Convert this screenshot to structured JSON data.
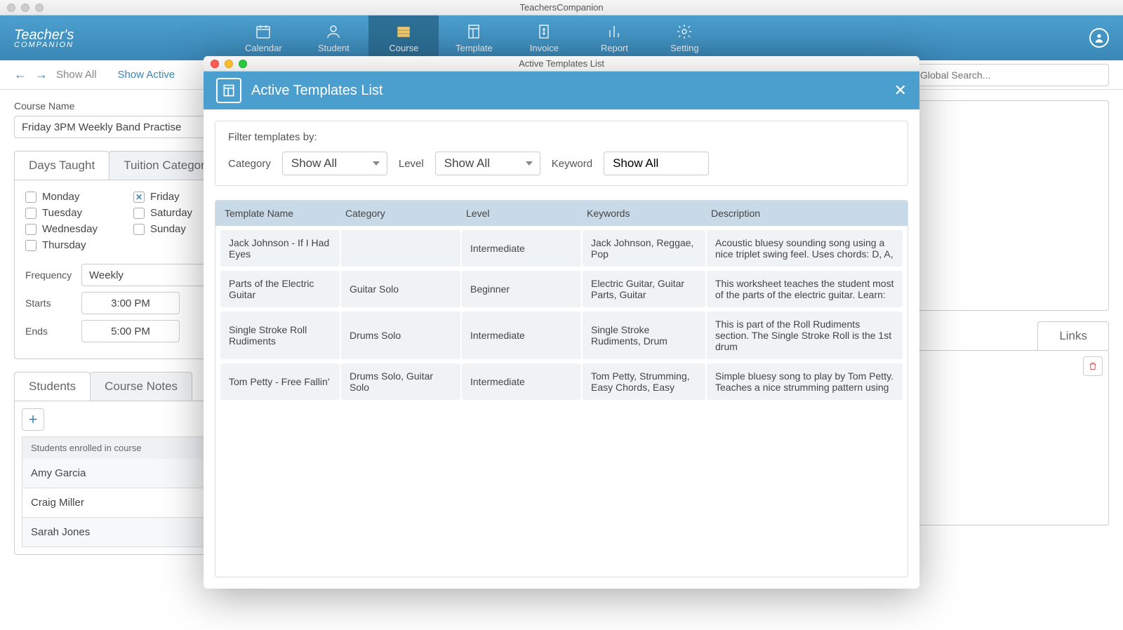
{
  "window": {
    "title": "TeachersCompanion"
  },
  "logo": {
    "line1": "Teacher's",
    "line2": "COMPANION"
  },
  "nav": {
    "items": [
      {
        "label": "Calendar"
      },
      {
        "label": "Student"
      },
      {
        "label": "Course"
      },
      {
        "label": "Template"
      },
      {
        "label": "Invoice"
      },
      {
        "label": "Report"
      },
      {
        "label": "Setting"
      }
    ]
  },
  "toolbar": {
    "show_all": "Show All",
    "show_active": "Show Active",
    "search_placeholder": "Global Search..."
  },
  "course": {
    "name_label": "Course Name",
    "name_value": "Friday 3PM Weekly Band Practise",
    "tabs": {
      "days": "Days Taught",
      "tuition": "Tuition Category"
    },
    "days": {
      "monday": "Monday",
      "tuesday": "Tuesday",
      "wednesday": "Wednesday",
      "thursday": "Thursday",
      "friday": "Friday",
      "saturday": "Saturday",
      "sunday": "Sunday"
    },
    "frequency_label": "Frequency",
    "frequency_value": "Weekly",
    "starts_label": "Starts",
    "starts_value": "3:00 PM",
    "ends_label": "Ends",
    "ends_value": "5:00 PM",
    "students_tab": "Students",
    "notes_tab": "Course Notes",
    "enrolled_header": "Students enrolled in course",
    "students": [
      "Amy Garcia",
      "Craig Miller",
      "Sarah Jones"
    ],
    "links_tab": "Links"
  },
  "modal": {
    "mac_title": "Active Templates List",
    "title": "Active Templates List",
    "filter_title": "Filter templates by:",
    "category_label": "Category",
    "category_value": "Show All",
    "level_label": "Level",
    "level_value": "Show All",
    "keyword_label": "Keyword",
    "keyword_value": "Show All",
    "columns": {
      "name": "Template Name",
      "category": "Category",
      "level": "Level",
      "keywords": "Keywords",
      "description": "Description"
    },
    "rows": [
      {
        "name": "Jack Johnson - If I Had Eyes",
        "category": "",
        "level": "Intermediate",
        "keywords": "Jack Johnson, Reggae, Pop",
        "description": "Acoustic bluesy sounding song using a nice triplet swing feel.  Uses chords: D, A,"
      },
      {
        "name": "Parts of the Electric Guitar",
        "category": "Guitar Solo",
        "level": "Beginner",
        "keywords": "Electric Guitar, Guitar Parts, Guitar",
        "description": "This worksheet teaches the student most of the parts of the electric guitar. Learn:"
      },
      {
        "name": "Single Stroke Roll Rudiments",
        "category": "Drums Solo",
        "level": "Intermediate",
        "keywords": "Single Stroke Rudiments, Drum",
        "description": "This is part of the Roll Rudiments section. The Single Stroke Roll is the 1st drum"
      },
      {
        "name": "Tom Petty - Free Fallin'",
        "category": "Drums Solo, Guitar Solo",
        "level": "Intermediate",
        "keywords": "Tom Petty, Strumming, Easy Chords, Easy",
        "description": "Simple bluesy song to play by Tom Petty. Teaches a nice strumming pattern using"
      }
    ]
  }
}
